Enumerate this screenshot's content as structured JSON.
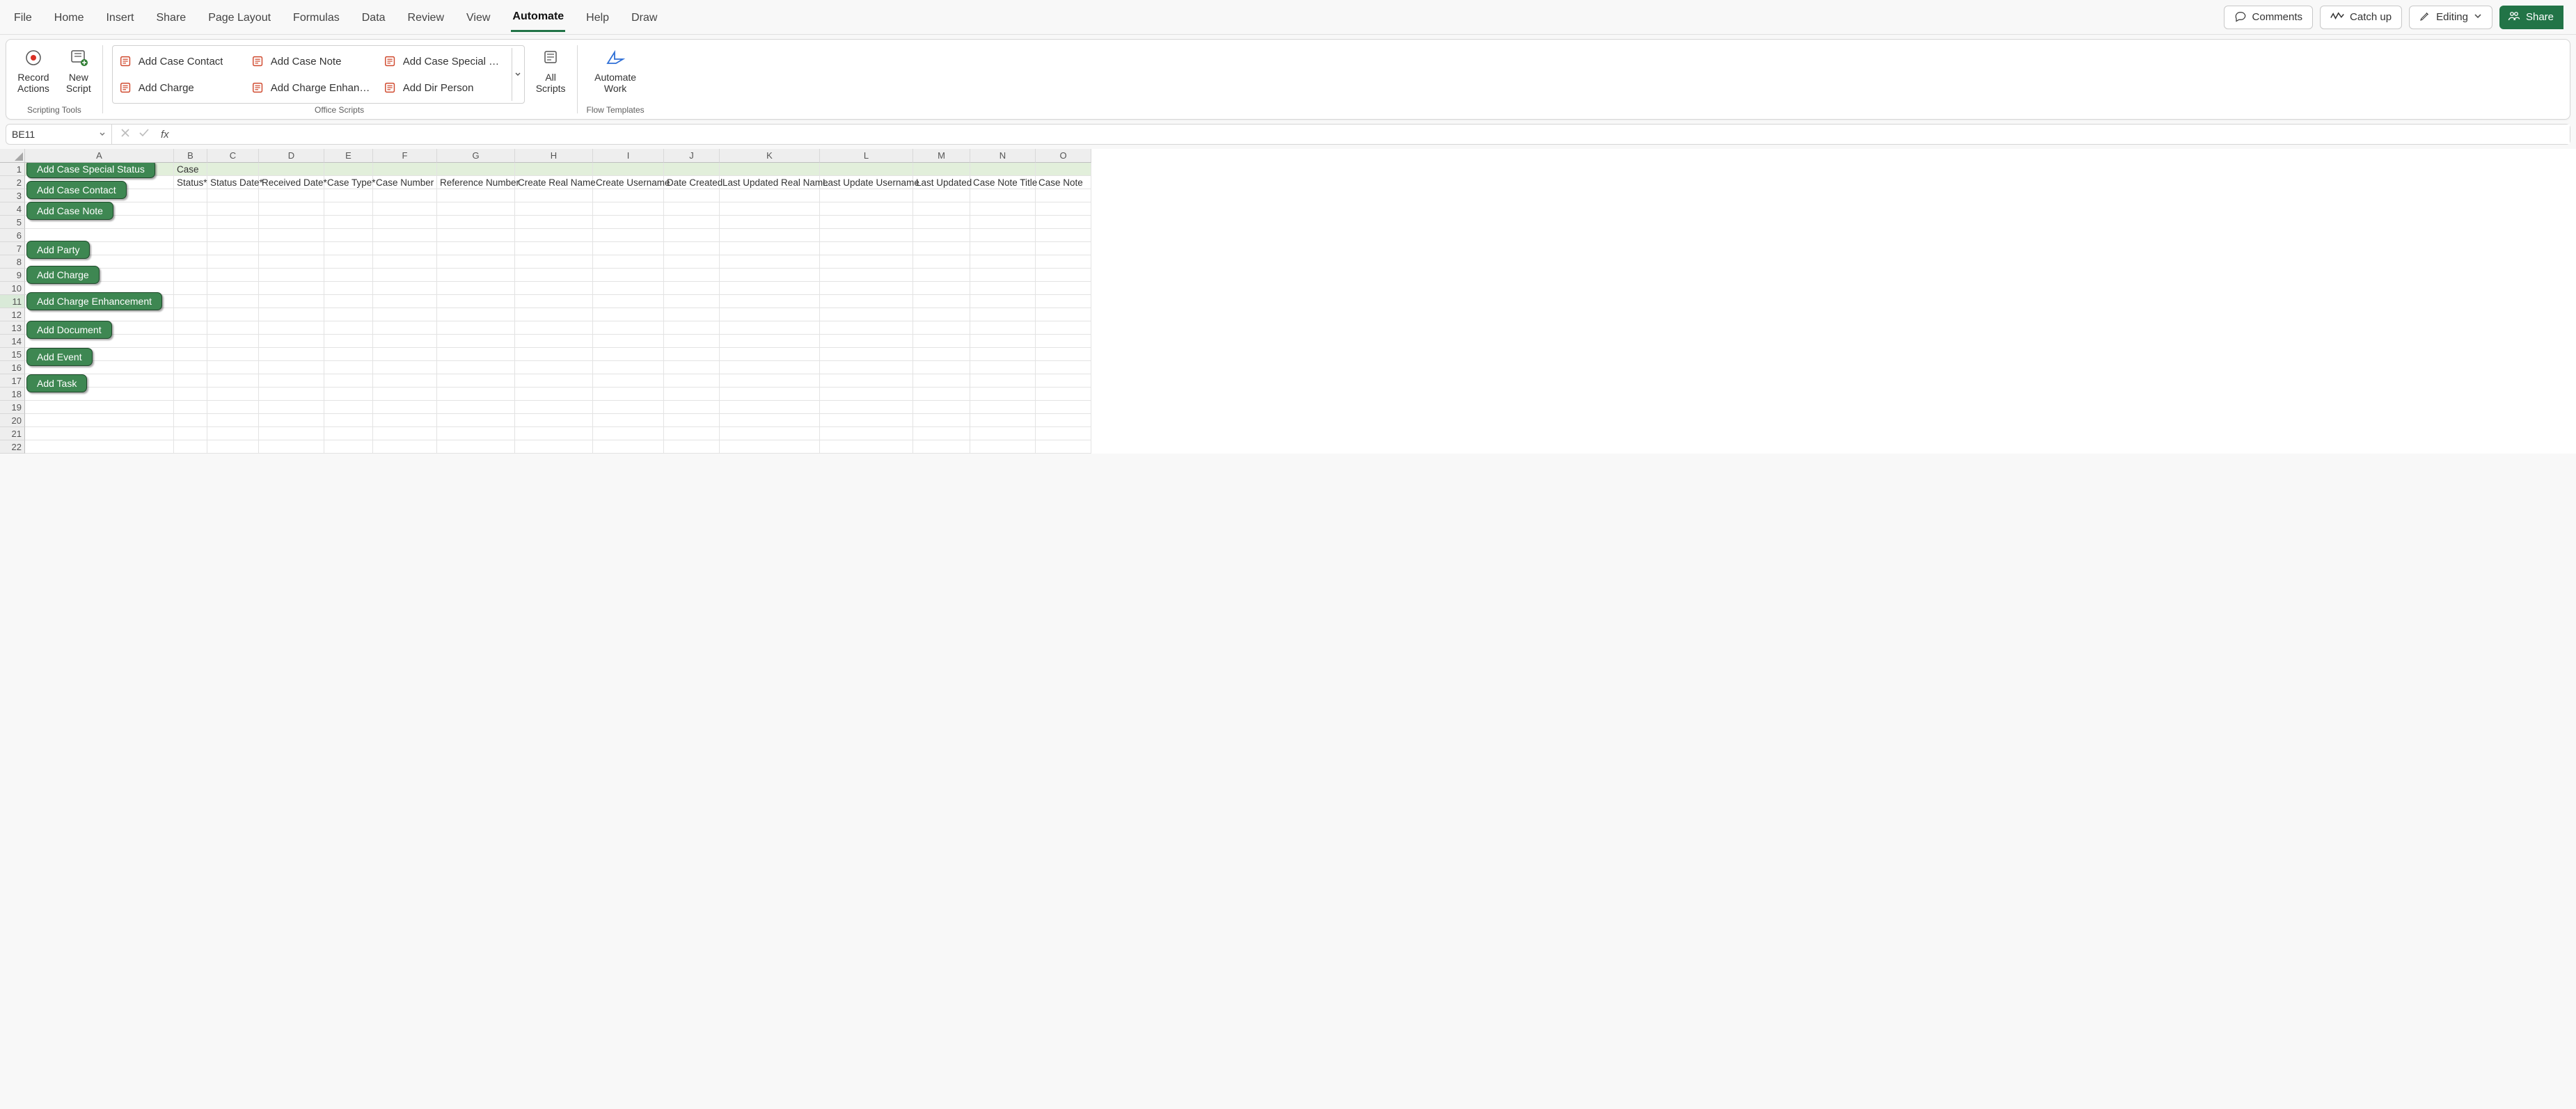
{
  "tabs": {
    "file": "File",
    "home": "Home",
    "insert": "Insert",
    "share_tab": "Share",
    "page_layout": "Page Layout",
    "formulas": "Formulas",
    "data": "Data",
    "review": "Review",
    "view": "View",
    "automate": "Automate",
    "help": "Help",
    "draw": "Draw"
  },
  "top_right": {
    "comments": "Comments",
    "catch_up": "Catch up",
    "editing": "Editing",
    "share": "Share"
  },
  "ribbon": {
    "record_actions": "Record\nActions",
    "new_script": "New\nScript",
    "scripting_tools": "Scripting Tools",
    "scripts": [
      "Add Case Contact",
      "Add Case Note",
      "Add Case Special St...",
      "Add Charge",
      "Add Charge Enhanc...",
      "Add Dir Person"
    ],
    "all_scripts": "All\nScripts",
    "office_scripts": "Office Scripts",
    "automate_work": "Automate\nWork",
    "flow_templates": "Flow Templates"
  },
  "name_box": "BE11",
  "sheet": {
    "banner": "Case",
    "headers": [
      "Status*",
      "Status Date*",
      "Received Date*",
      "Case Type*",
      "Case Number",
      "Reference Number",
      "Create Real Name",
      "Create Username",
      "Date Created",
      "Last Updated Real Name",
      "Last Update Username",
      "Last Updated",
      "Case Note Title",
      "Case Note"
    ],
    "col_letters": [
      "A",
      "B",
      "C",
      "D",
      "E",
      "F",
      "G",
      "H",
      "I",
      "J",
      "K",
      "L",
      "M",
      "N",
      "O"
    ]
  },
  "macro_buttons": [
    {
      "label": "Add Case Special Status",
      "row": 1
    },
    {
      "label": "Add Case Contact",
      "row": 2.6
    },
    {
      "label": "Add Case Note",
      "row": 4.15
    },
    {
      "label": "Add Party",
      "row": 7.1
    },
    {
      "label": "Add Charge",
      "row": 9.0
    },
    {
      "label": "Add Charge Enhancement",
      "row": 11.0
    },
    {
      "label": "Add Document",
      "row": 13.15
    },
    {
      "label": "Add Event",
      "row": 15.2
    },
    {
      "label": "Add Task",
      "row": 17.2
    }
  ]
}
